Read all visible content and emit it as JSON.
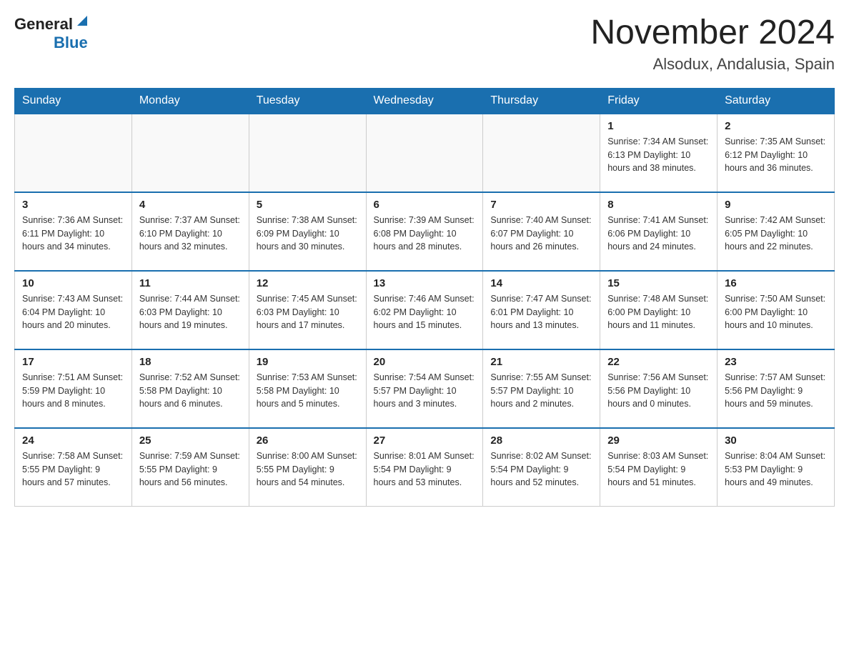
{
  "header": {
    "logo_general": "General",
    "logo_blue": "Blue",
    "title": "November 2024",
    "subtitle": "Alsodux, Andalusia, Spain"
  },
  "weekdays": [
    "Sunday",
    "Monday",
    "Tuesday",
    "Wednesday",
    "Thursday",
    "Friday",
    "Saturday"
  ],
  "weeks": [
    [
      {
        "day": "",
        "info": ""
      },
      {
        "day": "",
        "info": ""
      },
      {
        "day": "",
        "info": ""
      },
      {
        "day": "",
        "info": ""
      },
      {
        "day": "",
        "info": ""
      },
      {
        "day": "1",
        "info": "Sunrise: 7:34 AM\nSunset: 6:13 PM\nDaylight: 10 hours\nand 38 minutes."
      },
      {
        "day": "2",
        "info": "Sunrise: 7:35 AM\nSunset: 6:12 PM\nDaylight: 10 hours\nand 36 minutes."
      }
    ],
    [
      {
        "day": "3",
        "info": "Sunrise: 7:36 AM\nSunset: 6:11 PM\nDaylight: 10 hours\nand 34 minutes."
      },
      {
        "day": "4",
        "info": "Sunrise: 7:37 AM\nSunset: 6:10 PM\nDaylight: 10 hours\nand 32 minutes."
      },
      {
        "day": "5",
        "info": "Sunrise: 7:38 AM\nSunset: 6:09 PM\nDaylight: 10 hours\nand 30 minutes."
      },
      {
        "day": "6",
        "info": "Sunrise: 7:39 AM\nSunset: 6:08 PM\nDaylight: 10 hours\nand 28 minutes."
      },
      {
        "day": "7",
        "info": "Sunrise: 7:40 AM\nSunset: 6:07 PM\nDaylight: 10 hours\nand 26 minutes."
      },
      {
        "day": "8",
        "info": "Sunrise: 7:41 AM\nSunset: 6:06 PM\nDaylight: 10 hours\nand 24 minutes."
      },
      {
        "day": "9",
        "info": "Sunrise: 7:42 AM\nSunset: 6:05 PM\nDaylight: 10 hours\nand 22 minutes."
      }
    ],
    [
      {
        "day": "10",
        "info": "Sunrise: 7:43 AM\nSunset: 6:04 PM\nDaylight: 10 hours\nand 20 minutes."
      },
      {
        "day": "11",
        "info": "Sunrise: 7:44 AM\nSunset: 6:03 PM\nDaylight: 10 hours\nand 19 minutes."
      },
      {
        "day": "12",
        "info": "Sunrise: 7:45 AM\nSunset: 6:03 PM\nDaylight: 10 hours\nand 17 minutes."
      },
      {
        "day": "13",
        "info": "Sunrise: 7:46 AM\nSunset: 6:02 PM\nDaylight: 10 hours\nand 15 minutes."
      },
      {
        "day": "14",
        "info": "Sunrise: 7:47 AM\nSunset: 6:01 PM\nDaylight: 10 hours\nand 13 minutes."
      },
      {
        "day": "15",
        "info": "Sunrise: 7:48 AM\nSunset: 6:00 PM\nDaylight: 10 hours\nand 11 minutes."
      },
      {
        "day": "16",
        "info": "Sunrise: 7:50 AM\nSunset: 6:00 PM\nDaylight: 10 hours\nand 10 minutes."
      }
    ],
    [
      {
        "day": "17",
        "info": "Sunrise: 7:51 AM\nSunset: 5:59 PM\nDaylight: 10 hours\nand 8 minutes."
      },
      {
        "day": "18",
        "info": "Sunrise: 7:52 AM\nSunset: 5:58 PM\nDaylight: 10 hours\nand 6 minutes."
      },
      {
        "day": "19",
        "info": "Sunrise: 7:53 AM\nSunset: 5:58 PM\nDaylight: 10 hours\nand 5 minutes."
      },
      {
        "day": "20",
        "info": "Sunrise: 7:54 AM\nSunset: 5:57 PM\nDaylight: 10 hours\nand 3 minutes."
      },
      {
        "day": "21",
        "info": "Sunrise: 7:55 AM\nSunset: 5:57 PM\nDaylight: 10 hours\nand 2 minutes."
      },
      {
        "day": "22",
        "info": "Sunrise: 7:56 AM\nSunset: 5:56 PM\nDaylight: 10 hours\nand 0 minutes."
      },
      {
        "day": "23",
        "info": "Sunrise: 7:57 AM\nSunset: 5:56 PM\nDaylight: 9 hours\nand 59 minutes."
      }
    ],
    [
      {
        "day": "24",
        "info": "Sunrise: 7:58 AM\nSunset: 5:55 PM\nDaylight: 9 hours\nand 57 minutes."
      },
      {
        "day": "25",
        "info": "Sunrise: 7:59 AM\nSunset: 5:55 PM\nDaylight: 9 hours\nand 56 minutes."
      },
      {
        "day": "26",
        "info": "Sunrise: 8:00 AM\nSunset: 5:55 PM\nDaylight: 9 hours\nand 54 minutes."
      },
      {
        "day": "27",
        "info": "Sunrise: 8:01 AM\nSunset: 5:54 PM\nDaylight: 9 hours\nand 53 minutes."
      },
      {
        "day": "28",
        "info": "Sunrise: 8:02 AM\nSunset: 5:54 PM\nDaylight: 9 hours\nand 52 minutes."
      },
      {
        "day": "29",
        "info": "Sunrise: 8:03 AM\nSunset: 5:54 PM\nDaylight: 9 hours\nand 51 minutes."
      },
      {
        "day": "30",
        "info": "Sunrise: 8:04 AM\nSunset: 5:53 PM\nDaylight: 9 hours\nand 49 minutes."
      }
    ]
  ]
}
